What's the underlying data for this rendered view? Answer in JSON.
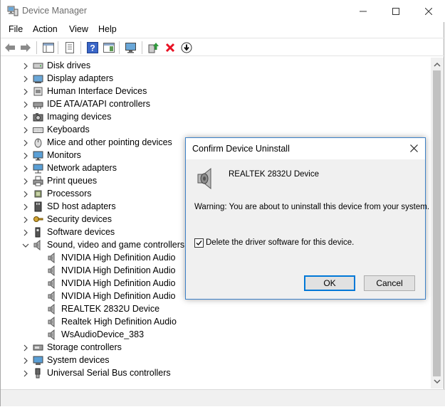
{
  "window": {
    "title": "Device Manager"
  },
  "menu": [
    "File",
    "Action",
    "View",
    "Help"
  ],
  "tree": [
    {
      "label": "Disk drives",
      "icon": "disk-drive-icon",
      "expanded": false
    },
    {
      "label": "Display adapters",
      "icon": "display-adapter-icon",
      "expanded": false
    },
    {
      "label": "Human Interface Devices",
      "icon": "hid-icon",
      "expanded": false
    },
    {
      "label": "IDE ATA/ATAPI controllers",
      "icon": "ide-controller-icon",
      "expanded": false
    },
    {
      "label": "Imaging devices",
      "icon": "camera-icon",
      "expanded": false
    },
    {
      "label": "Keyboards",
      "icon": "keyboard-icon",
      "expanded": false
    },
    {
      "label": "Mice and other pointing devices",
      "icon": "mouse-icon",
      "expanded": false
    },
    {
      "label": "Monitors",
      "icon": "monitor-icon",
      "expanded": false
    },
    {
      "label": "Network adapters",
      "icon": "network-icon",
      "expanded": false
    },
    {
      "label": "Print queues",
      "icon": "printer-icon",
      "expanded": false
    },
    {
      "label": "Processors",
      "icon": "processor-icon",
      "expanded": false
    },
    {
      "label": "SD host adapters",
      "icon": "sd-card-icon",
      "expanded": false
    },
    {
      "label": "Security devices",
      "icon": "security-key-icon",
      "expanded": false
    },
    {
      "label": "Software devices",
      "icon": "software-device-icon",
      "expanded": false
    },
    {
      "label": "Sound, video and game controllers",
      "icon": "speaker-icon",
      "expanded": true
    },
    {
      "label": "NVIDIA High Definition Audio",
      "icon": "speaker-icon",
      "child": true
    },
    {
      "label": "NVIDIA High Definition Audio",
      "icon": "speaker-icon",
      "child": true
    },
    {
      "label": "NVIDIA High Definition Audio",
      "icon": "speaker-icon",
      "child": true
    },
    {
      "label": "NVIDIA High Definition Audio",
      "icon": "speaker-icon",
      "child": true
    },
    {
      "label": "REALTEK 2832U Device",
      "icon": "speaker-icon",
      "child": true
    },
    {
      "label": "Realtek High Definition Audio",
      "icon": "speaker-icon",
      "child": true
    },
    {
      "label": "WsAudioDevice_383",
      "icon": "speaker-icon",
      "child": true
    },
    {
      "label": "Storage controllers",
      "icon": "storage-controller-icon",
      "expanded": false
    },
    {
      "label": "System devices",
      "icon": "system-device-icon",
      "expanded": false
    },
    {
      "label": "Universal Serial Bus controllers",
      "icon": "usb-icon",
      "expanded": false
    }
  ],
  "dialog": {
    "title": "Confirm Device Uninstall",
    "device_name": "REALTEK 2832U Device",
    "warning": "Warning: You are about to uninstall this device from your system.",
    "checkbox_label": "Delete the driver software for this device.",
    "checkbox_checked": true,
    "ok_label": "OK",
    "cancel_label": "Cancel"
  },
  "colors": {
    "accent": "#0078d7",
    "dialog_border": "#3c80c6",
    "uninstall_red": "#e81123",
    "update_green": "#2e9b3c"
  }
}
